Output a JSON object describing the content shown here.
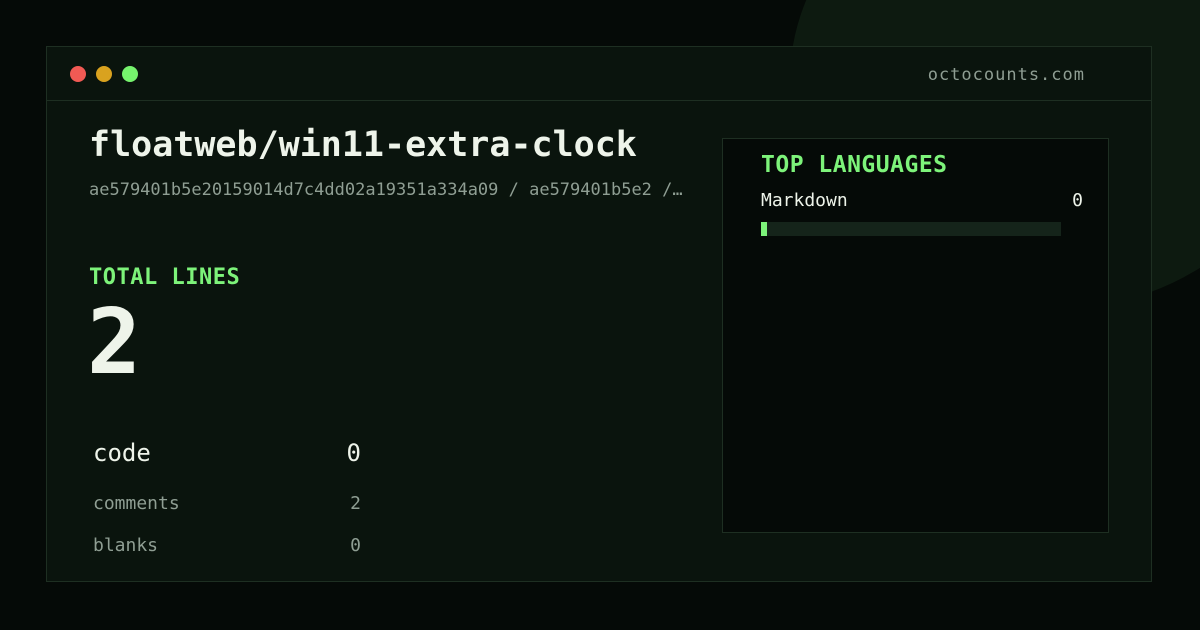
{
  "window": {
    "domain": "octocounts.com"
  },
  "repo": {
    "name": "floatweb/win11-extra-clock",
    "commit": "ae579401b5e20159014d7c4dd02a19351a334a09 / ae579401b5e2 /…"
  },
  "totals": {
    "label": "TOTAL LINES",
    "value": "2"
  },
  "stats": {
    "code": {
      "label": "code",
      "value": "0"
    },
    "comments": {
      "label": "comments",
      "value": "2"
    },
    "blanks": {
      "label": "blanks",
      "value": "0"
    }
  },
  "languages": {
    "title": "TOP LANGUAGES",
    "items": [
      {
        "name": "Markdown",
        "value": "0",
        "fraction": 0
      }
    ]
  },
  "colors": {
    "accent": "#7df37a",
    "traffic_red": "#f15a54",
    "traffic_yellow": "#d9a21f",
    "traffic_green": "#76f36d"
  }
}
